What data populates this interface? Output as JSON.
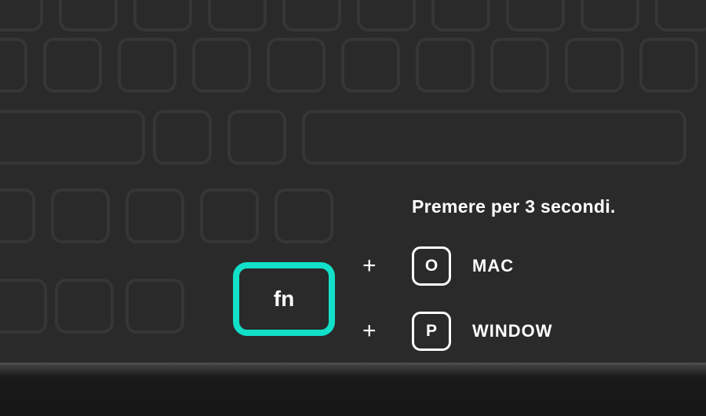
{
  "instruction": "Premere per 3 secondi.",
  "keys": {
    "fn": "fn",
    "o": "O",
    "p": "P"
  },
  "labels": {
    "mac": "MAC",
    "window": "WINDOW"
  },
  "symbols": {
    "plus": "+"
  },
  "colors": {
    "accent": "#12e0c9",
    "background": "#2a2a2a",
    "text": "#ffffff"
  }
}
